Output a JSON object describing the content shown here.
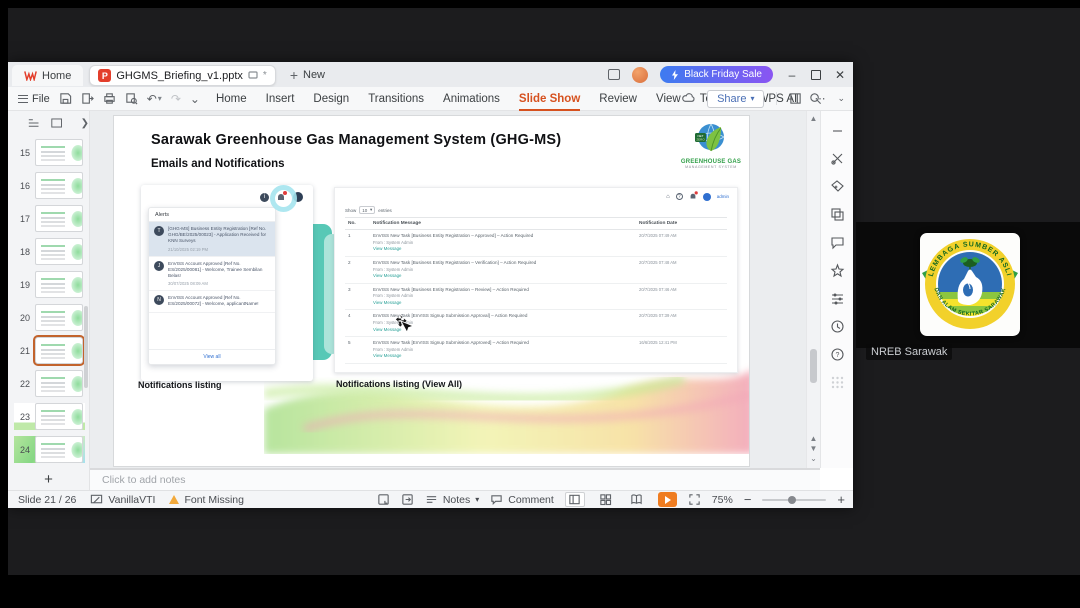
{
  "titlebar": {
    "home_label": "Home",
    "doc_label": "GHGMS_Briefing_v1.pptx",
    "new_label": "New",
    "promo_label": "Black Friday Sale"
  },
  "menubar": {
    "file_label": "File",
    "items": [
      {
        "label": "Home"
      },
      {
        "label": "Insert"
      },
      {
        "label": "Design"
      },
      {
        "label": "Transitions"
      },
      {
        "label": "Animations"
      },
      {
        "label": "Slide Show"
      },
      {
        "label": "Review"
      },
      {
        "label": "View"
      },
      {
        "label": "Tools"
      }
    ],
    "active": "Slide Show",
    "wps_ai_label": "WPS AI",
    "share_label": "Share"
  },
  "slide_panel": {
    "selected": 21,
    "add_label": "+",
    "slides": [
      {
        "num": 15,
        "variant": "form"
      },
      {
        "num": 16,
        "variant": "yellow"
      },
      {
        "num": 17,
        "variant": "dots"
      },
      {
        "num": 18,
        "variant": "doc"
      },
      {
        "num": 19,
        "variant": "doc"
      },
      {
        "num": 20,
        "variant": "doc"
      },
      {
        "num": 21,
        "variant": "list"
      },
      {
        "num": 22,
        "variant": "dark"
      },
      {
        "num": 23,
        "variant": "bar"
      },
      {
        "num": 24,
        "variant": "full"
      }
    ]
  },
  "slide": {
    "title": "Sarawak Greenhouse Gas Management System (GHG-MS)",
    "subtitle": "Emails and Notifications",
    "logo": {
      "badge": "NET ZERO 2050",
      "name_line1": "GREENHOUSE GAS",
      "name_line2": "MANAGEMENT SYSTEM"
    },
    "alerts": {
      "header": "Alerts",
      "view_all": "View all",
      "items": [
        {
          "avatar": "T",
          "text": "[GHG-MS] Business Entity Registration [Ref No. GHG/BE/2025/00023] - Application Received for KNN Surveys",
          "time": "21/10/2025 02:19 PM",
          "highlight": true
        },
        {
          "avatar": "J",
          "text": "EnVISS Account Approved [Ref No. ES/2025/00081] - Welcome, Trainee Sembilan Belas!",
          "time": "30/07/2025 08:09 AM"
        },
        {
          "avatar": "N",
          "text": "EnVISS Account Approved [Ref No. ES/2025/00072] - Welcome, applicantName!",
          "time": ""
        }
      ]
    },
    "shot_right": {
      "admin_label": "admin",
      "show_label": "Show",
      "show_value": "10",
      "entries_label": "entries",
      "header_no": "No.",
      "header_message": "Notification Message",
      "header_date": "Notification Date",
      "rows": [
        {
          "no": "1",
          "message": "EnVISS New Task [Business Entity Registration – Approved] – Action Required",
          "from": "From : System Admin",
          "link": "View Message",
          "date": "20/7/2025 07:49 AM"
        },
        {
          "no": "2",
          "message": "EnVISS New Task [Business Entity Registration – Verification] – Action Required",
          "from": "From : System Admin",
          "link": "View Message",
          "date": "20/7/2025 07:48 AM"
        },
        {
          "no": "3",
          "message": "EnVISS New Task [Business Entity Registration – Review] – Action Required",
          "from": "From : System Admin",
          "link": "View Message",
          "date": "20/7/2025 07:46 AM"
        },
        {
          "no": "4",
          "message": "EnVISS New Task [EnVISS Signup Submission Approval] – Action Required",
          "from": "From : System Admin",
          "link": "View Message",
          "date": "20/7/2025 07:39 AM"
        },
        {
          "no": "5",
          "message": "EnVISS New Task [EnVISS Signup Submission Approved] – Action Required",
          "from": "From : System Admin",
          "link": "View Message",
          "date": "16/6/2025 12:41 PM"
        }
      ]
    },
    "caption_left": "Notifications listing",
    "caption_right": "Notifications listing (View All)"
  },
  "notes": {
    "placeholder": "Click to add notes"
  },
  "statusbar": {
    "slide_indicator": "Slide 21 / 26",
    "theme_name": "VanillaVTI",
    "font_missing": "Font Missing",
    "notes_label": "Notes",
    "comment_label": "Comment",
    "zoom_level": "75%"
  },
  "participant": {
    "label": "NREB Sarawak",
    "arc_top": "LEMBAGA SUMBER ASLI",
    "arc_bottom": "DAN ALAM SEKITAR SARAWAK"
  }
}
